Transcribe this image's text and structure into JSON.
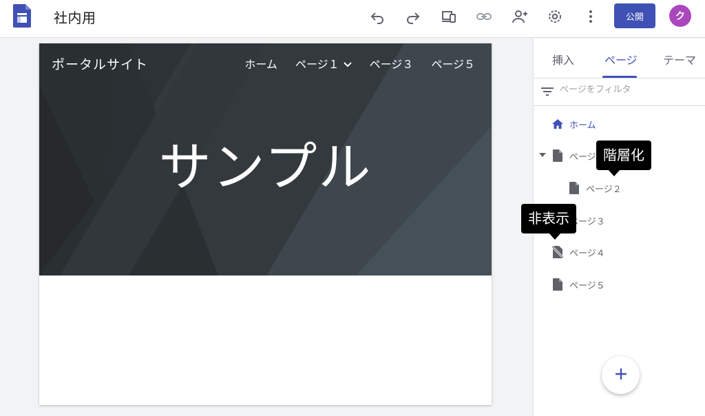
{
  "header": {
    "doc_title": "社内用",
    "publish_label": "公開",
    "avatar_initial": "ク",
    "toolbar_icons": [
      "undo-icon",
      "redo-icon",
      "preview-icon",
      "link-icon",
      "share-icon",
      "settings-icon",
      "more-vert-icon"
    ]
  },
  "site": {
    "name": "ポータルサイト",
    "nav": [
      "ホーム",
      "ページ１",
      "ページ３",
      "ページ５"
    ],
    "hero_title": "サンプル"
  },
  "panel": {
    "tabs": [
      "挿入",
      "ページ",
      "テーマ"
    ],
    "active_tab": "ページ",
    "filter_placeholder": "ページをフィルタ",
    "pages": {
      "home": "ホーム",
      "page1": "ページ１",
      "page2": "ページ２",
      "page3": "ページ３",
      "page4": "ページ４",
      "page5": "ページ５"
    },
    "tooltips": {
      "hierarchy": "階層化",
      "hidden": "非表示"
    }
  },
  "colors": {
    "accent": "#3f51b5",
    "avatar": "#ab47bc",
    "hero_bg": "#2e3337"
  }
}
